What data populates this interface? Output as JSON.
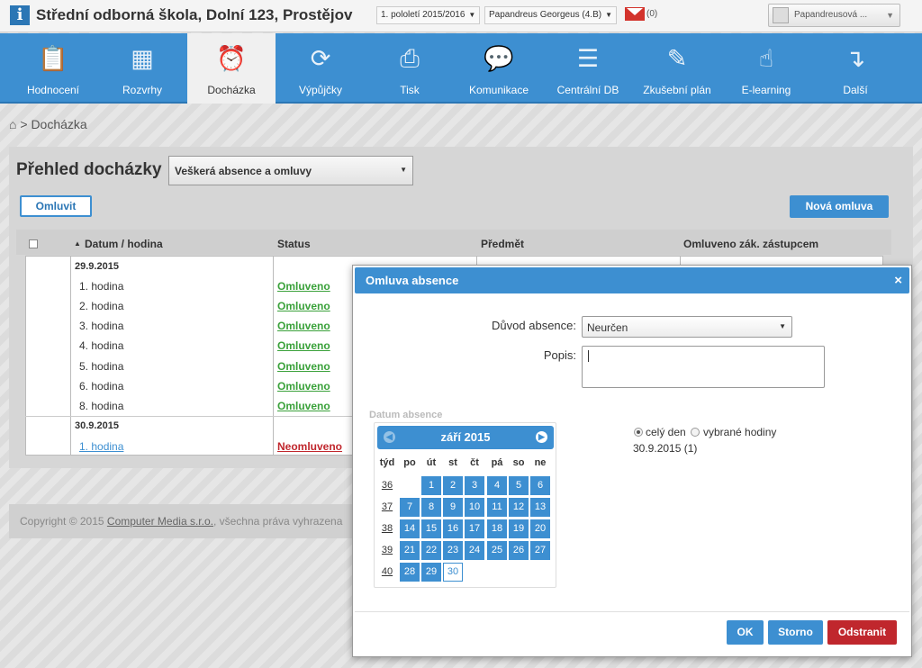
{
  "header": {
    "logo_letter": "i",
    "school_title": "Střední odborná škola, Dolní 123, Prostějov",
    "period_select": "1. pololetí 2015/2016",
    "student_select": "Papandreus Georgeus (4.B)",
    "mail_count": "(0)",
    "user_name": "Papandreusová ..."
  },
  "nav": {
    "items": [
      {
        "label": "Hodnocení",
        "icon": "clipboard-check-icon"
      },
      {
        "label": "Rozvrhy",
        "icon": "calendar-grid-icon"
      },
      {
        "label": "Docházka",
        "icon": "alarm-clock-icon",
        "active": true
      },
      {
        "label": "Výpůjčky",
        "icon": "refresh-arrows-icon"
      },
      {
        "label": "Tisk",
        "icon": "printer-icon"
      },
      {
        "label": "Komunikace",
        "icon": "chat-bubbles-icon"
      },
      {
        "label": "Centrální DB",
        "icon": "database-icon"
      },
      {
        "label": "Zkušební plán",
        "icon": "edit-pencil-icon"
      },
      {
        "label": "E-learning",
        "icon": "mouse-hand-icon"
      },
      {
        "label": "Další",
        "icon": "arrow-down-right-icon"
      }
    ]
  },
  "breadcrumb": {
    "separator": ">",
    "current": "Docházka"
  },
  "page": {
    "title": "Přehled docházky",
    "filter": "Veškerá absence a omluvy",
    "excuse_button": "Omluvit",
    "new_excuse_button": "Nová omluva"
  },
  "table": {
    "columns": [
      "Datum / hodina",
      "Status",
      "Předmět",
      "Omluveno zák. zástupcem"
    ],
    "sort_indicator": "▲",
    "groups": [
      {
        "date": "29.9.2015",
        "rows": [
          {
            "hour": "1. hodina",
            "status": "Omluveno"
          },
          {
            "hour": "2. hodina",
            "status": "Omluveno"
          },
          {
            "hour": "3. hodina",
            "status": "Omluveno"
          },
          {
            "hour": "4. hodina",
            "status": "Omluveno"
          },
          {
            "hour": "5. hodina",
            "status": "Omluveno"
          },
          {
            "hour": "6. hodina",
            "status": "Omluveno"
          },
          {
            "hour": "8. hodina",
            "status": "Omluveno"
          }
        ]
      },
      {
        "date": "30.9.2015",
        "rows": [
          {
            "hour": "1. hodina",
            "status": "Neomluveno"
          }
        ]
      }
    ]
  },
  "footer": {
    "prefix": "Copyright © 2015 ",
    "company": "Computer Media s.r.o.",
    "suffix": ", všechna práva vyhrazena"
  },
  "modal": {
    "title": "Omluva absence",
    "close": "×",
    "reason_label": "Důvod absence:",
    "reason_value": "Neurčen",
    "description_label": "Popis:",
    "date_section": "Datum absence",
    "calendar": {
      "month": "září 2015",
      "dow": [
        "týd",
        "po",
        "út",
        "st",
        "čt",
        "pá",
        "so",
        "ne"
      ],
      "weeks": [
        "36",
        "37",
        "38",
        "39",
        "40"
      ]
    },
    "whole_day": "celý den",
    "selected_hours": "vybrané hodiny",
    "selected_date": "30.9.2015 (1)",
    "ok": "OK",
    "cancel": "Storno",
    "remove": "Odstranit"
  },
  "colors": {
    "accent": "#3d8fd1",
    "excused": "#3aa13a",
    "unexcused": "#c0272d",
    "remove": "#c0272d"
  }
}
